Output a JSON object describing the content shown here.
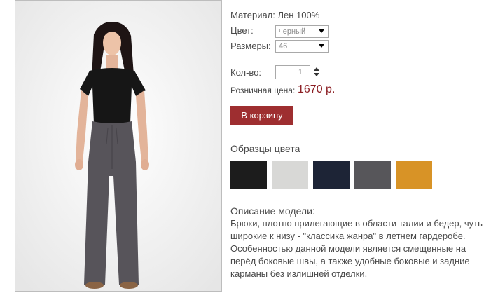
{
  "product": {
    "image_alt": "photo-of-model-in-linen-trousers"
  },
  "specs": {
    "material": "Материал: Лен 100%",
    "color_label": "Цвет:",
    "color_value": "черный",
    "size_label": "Размеры:",
    "size_value": "46",
    "qty_label": "Кол-во:",
    "qty_value": "1",
    "price_label": "Розничная цена:",
    "price_value": "1670 р."
  },
  "cart": {
    "button_label": "В корзину",
    "accent": "#9e2e30"
  },
  "swatches": {
    "title": "Образцы цвета",
    "items": [
      {
        "name": "black",
        "color": "#1c1c1c"
      },
      {
        "name": "light-gray",
        "color": "#d8d8d6"
      },
      {
        "name": "navy",
        "color": "#1d2436"
      },
      {
        "name": "dark-gray",
        "color": "#57565a"
      },
      {
        "name": "mustard",
        "color": "#d89326"
      }
    ]
  },
  "description": {
    "title": "Описание модели:",
    "text": "Брюки, плотно прилегающие в области талии и бедер, чуть широкие к низу - \"классика жанра\" в летнем гардеробе. Особенностью данной модели является смещенные на перёд боковые швы, а также удобные боковые и задние карманы без излишней отделки."
  }
}
